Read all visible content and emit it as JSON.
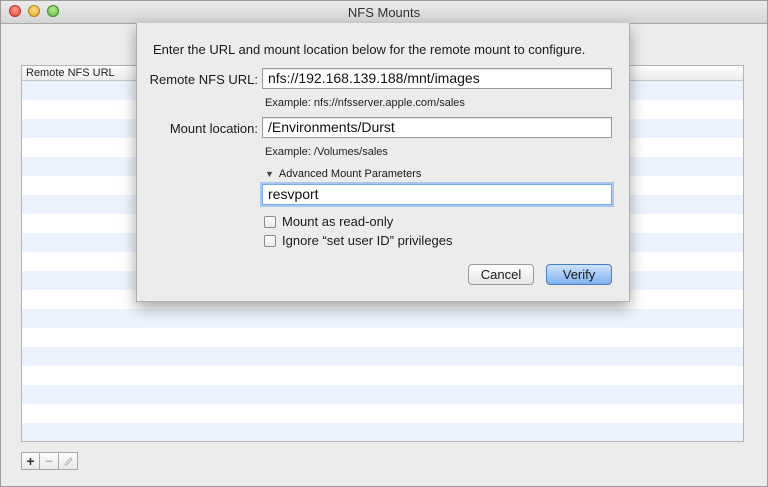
{
  "window": {
    "title": "NFS Mounts"
  },
  "table": {
    "column_header": "Remote NFS URL",
    "rows": []
  },
  "bottom_buttons": {
    "add": "+",
    "remove": "−"
  },
  "sheet": {
    "prompt": "Enter the URL and mount location below for the remote mount to configure.",
    "remote_url_label": "Remote NFS URL:",
    "remote_url_value": "nfs://192.168.139.188/mnt/images",
    "remote_url_example": "Example: nfs://nfsserver.apple.com/sales",
    "mount_location_label": "Mount location:",
    "mount_location_value": "/Environments/Durst",
    "mount_location_example": "Example: /Volumes/sales",
    "advanced_label": "Advanced Mount Parameters",
    "advanced_value": "resvport",
    "read_only_label": "Mount as read-only",
    "read_only_checked": false,
    "ignore_setuid_label": "Ignore “set user ID” privileges",
    "ignore_setuid_checked": false,
    "cancel_label": "Cancel",
    "verify_label": "Verify"
  },
  "colors": {
    "row_alt": "#edf3fe",
    "default_button": "#7fb0ef"
  },
  "icons": {
    "disclosure": "disclosure-triangle-down-icon",
    "edit": "pencil-icon"
  }
}
